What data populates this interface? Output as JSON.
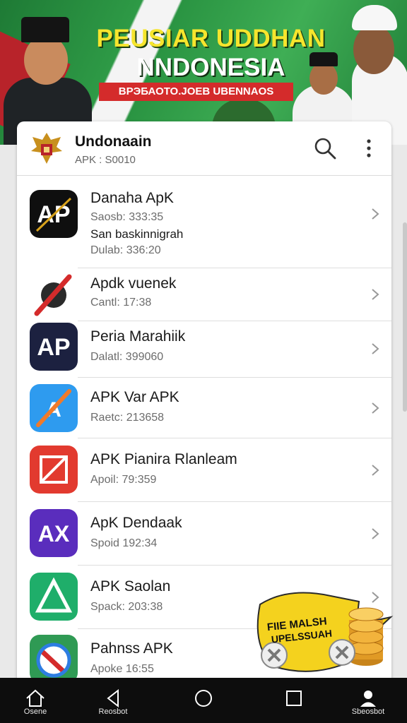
{
  "banner": {
    "title_line1": "PEUSIAR UDDHAN",
    "title_line2": "NNDONESIA",
    "strip_text": "ВРЭБАОТО.ЈОЕВ UBENNAOS",
    "colors": {
      "green": "#2e9a46",
      "yellow": "#f6e52d",
      "red": "#d42b2b"
    }
  },
  "header": {
    "title": "Undonaain",
    "subtitle": "APK : S0010",
    "emblem_icon": "garuda-emblem-icon",
    "search_icon": "search-icon",
    "more_icon": "more-vertical-icon"
  },
  "apps": [
    {
      "name": "Danaha ApK",
      "line1": "Saosb: 333:35",
      "line2": "San baskinnigrah",
      "line3": "Dulab: 336:20",
      "icon": "ap-black-icon"
    },
    {
      "name": "Apdk vuenek",
      "line1": "Cantl: 17:38",
      "icon": "crossed-pen-icon"
    },
    {
      "name": "Peria Marahiik",
      "line1": "Dalatl: 399060",
      "icon": "ap-navy-icon"
    },
    {
      "name": "APK Var APK",
      "line1": "Raetc: 213658",
      "icon": "ap-blue-icon"
    },
    {
      "name": "APK Pianira Rlanleam",
      "line1": "Apoil: 79:359",
      "icon": "ap-red-icon"
    },
    {
      "name": "ApK Dendaak",
      "line1": "Spoid 192:34",
      "icon": "ax-purple-icon"
    },
    {
      "name": "APK Saolan",
      "line1": "Spack: 203:38",
      "icon": "triangle-green-icon"
    },
    {
      "name": "Pahnss APK",
      "line1": "Apoke 16:55",
      "icon": "circle-blue-icon"
    }
  ],
  "promo": {
    "text_line1": "FIIE MALSH",
    "text_line2": "UPELSSUAH",
    "icon": "coin-stack-icon"
  },
  "nav": [
    {
      "label": "Osene",
      "icon": "home-icon"
    },
    {
      "label": "Reosbot",
      "icon": "back-triangle-icon"
    },
    {
      "label": "",
      "icon": "home-circle-icon"
    },
    {
      "label": "",
      "icon": "recents-square-icon"
    },
    {
      "label": "Sbeosbot",
      "icon": "user-icon"
    }
  ]
}
